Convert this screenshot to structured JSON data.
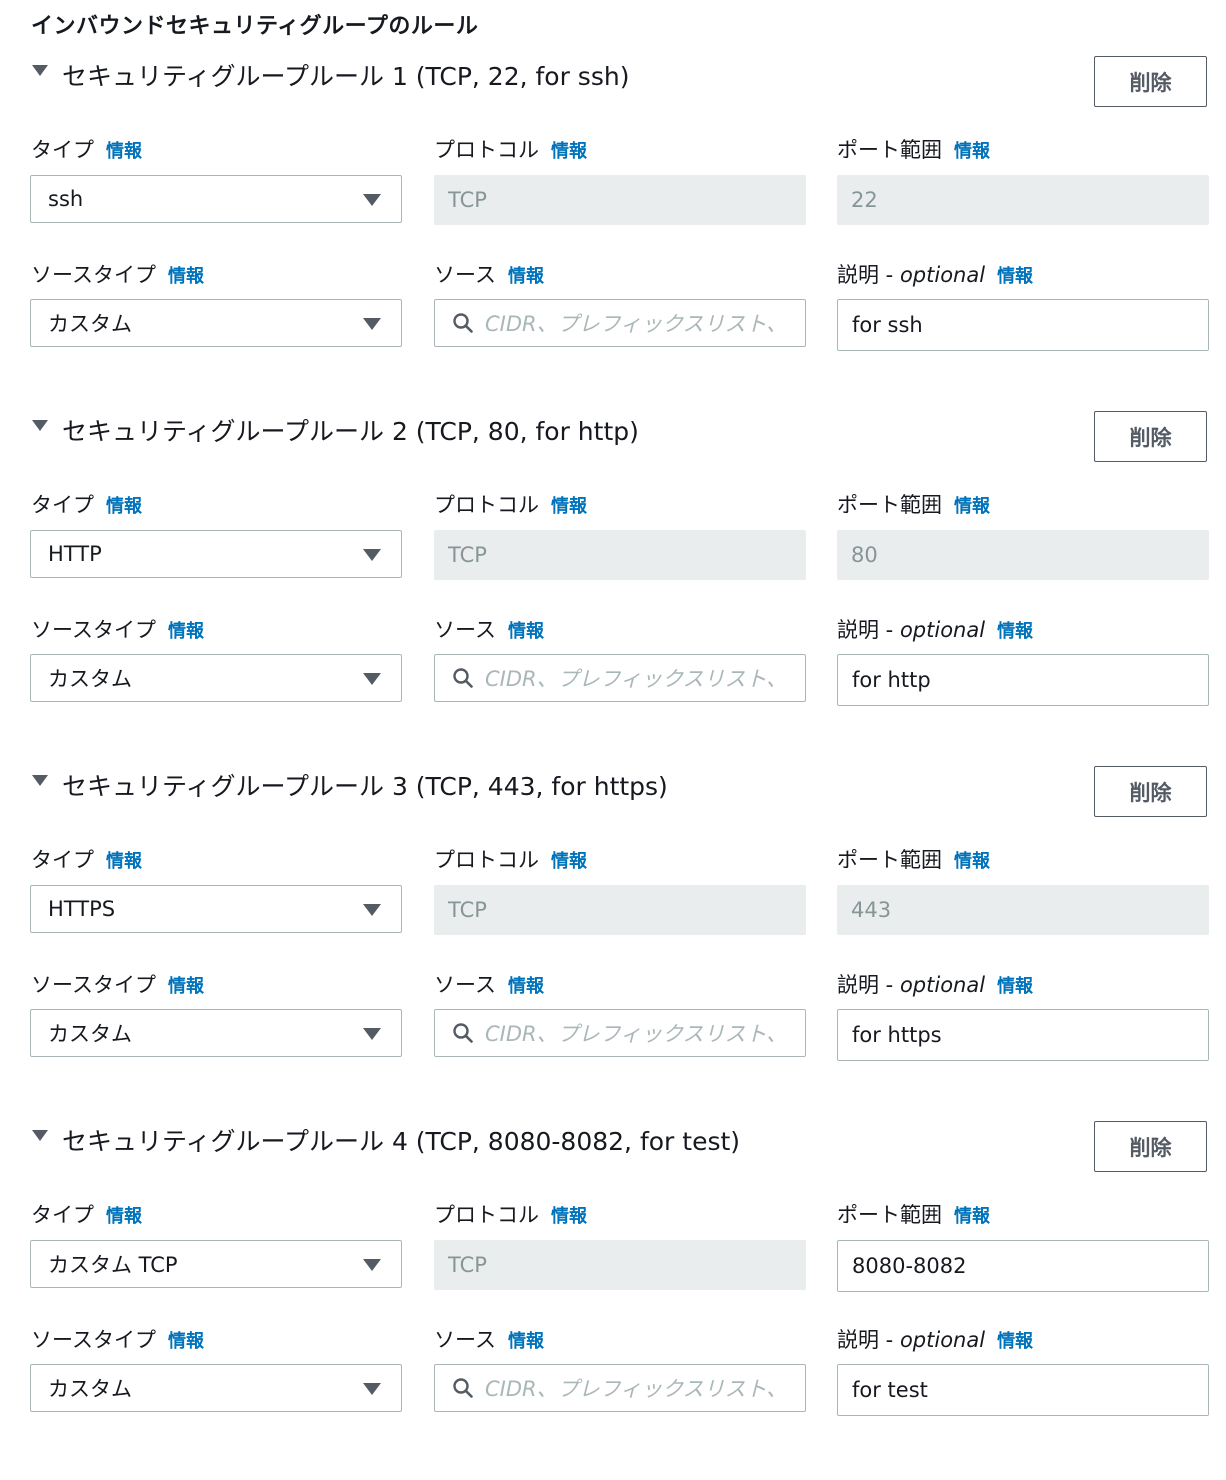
{
  "page_title": "インバウンドセキュリティグループのルール",
  "labels": {
    "type": "タイプ",
    "protocol": "プロトコル",
    "port_range": "ポート範囲",
    "source_type": "ソースタイプ",
    "source": "ソース",
    "description": "説明 -",
    "optional": "optional",
    "info": "情報",
    "delete": "削除",
    "source_placeholder": "CIDR、プレフィックスリスト、"
  },
  "rules": [
    {
      "title": "セキュリティグループルール 1 (TCP, 22, for ssh)",
      "type": "ssh",
      "protocol": "TCP",
      "port": "22",
      "source_type": "カスタム",
      "description": "for ssh"
    },
    {
      "title": "セキュリティグループルール 2 (TCP, 80, for http)",
      "type": "HTTP",
      "protocol": "TCP",
      "port": "80",
      "source_type": "カスタム",
      "description": "for http"
    },
    {
      "title": "セキュリティグループルール 3 (TCP, 443, for https)",
      "type": "HTTPS",
      "protocol": "TCP",
      "port": "443",
      "source_type": "カスタム",
      "description": "for https"
    },
    {
      "title": "セキュリティグループルール 4 (TCP, 8080-8082, for test)",
      "type": "カスタム TCP",
      "protocol": "TCP",
      "port": "8080-8082",
      "source_type": "カスタム",
      "description": "for test"
    }
  ]
}
